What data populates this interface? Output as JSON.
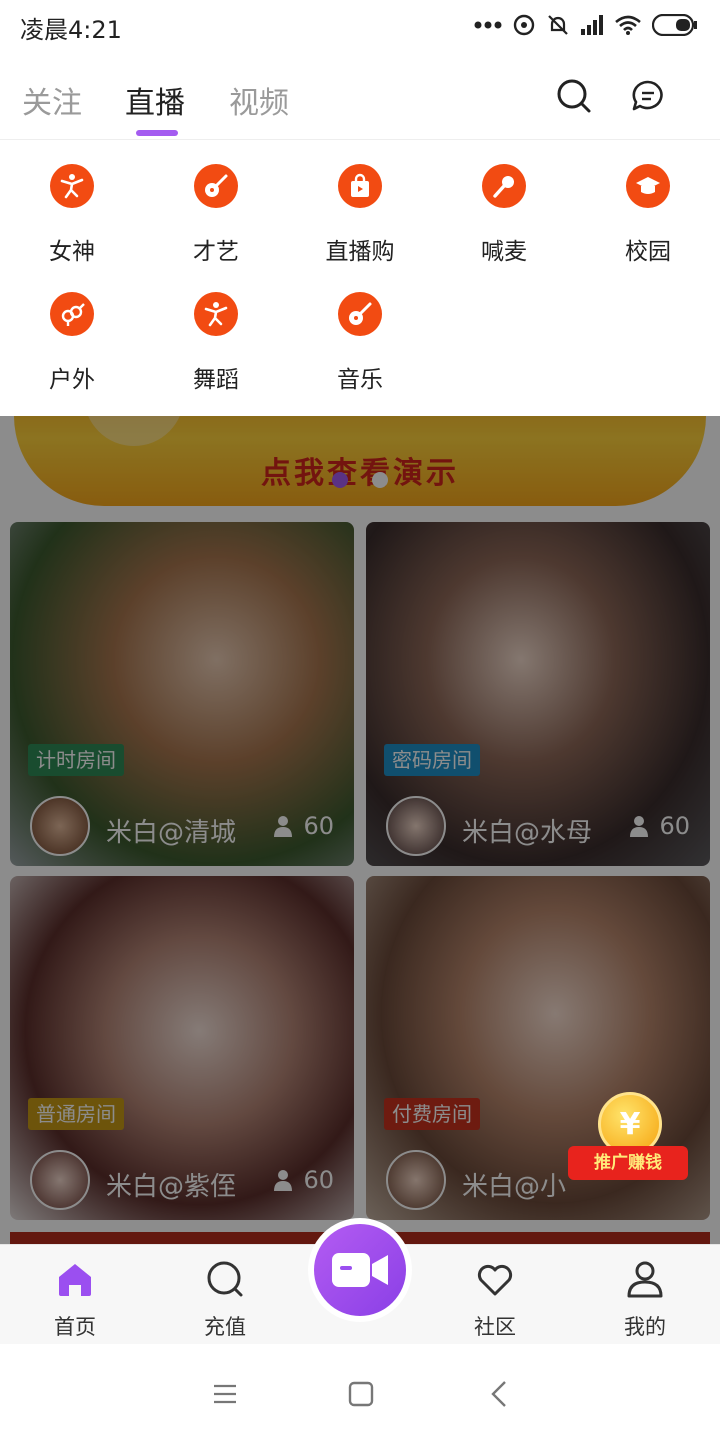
{
  "status_bar": {
    "time": "凌晨4:21"
  },
  "top_nav": {
    "tabs": [
      {
        "label": "关注",
        "active": false
      },
      {
        "label": "直播",
        "active": true
      },
      {
        "label": "视频",
        "active": false
      }
    ],
    "accent_color": "#a45cf0",
    "icons": [
      "search-icon",
      "message-icon"
    ]
  },
  "categories": [
    {
      "label": "女神",
      "icon": "dancer-icon"
    },
    {
      "label": "才艺",
      "icon": "guitar-icon"
    },
    {
      "label": "直播购",
      "icon": "shopping-bag-icon"
    },
    {
      "label": "喊麦",
      "icon": "microphone-icon"
    },
    {
      "label": "校园",
      "icon": "graduation-cap-icon"
    },
    {
      "label": "户外",
      "icon": "gender-icon"
    },
    {
      "label": "舞蹈",
      "icon": "dancer-icon"
    },
    {
      "label": "音乐",
      "icon": "guitar-icon"
    }
  ],
  "category_icon_color": "#f24b12",
  "banner": {
    "text": "点我查看演示",
    "active_dot": 0,
    "dot_count": 2
  },
  "cards": [
    {
      "room_type": "计时房间",
      "badge_color": "#2e8b57",
      "streamer": "米白@清城",
      "viewers": "60"
    },
    {
      "room_type": "密码房间",
      "badge_color": "#1e90c8",
      "streamer": "米白@水母",
      "viewers": "60"
    },
    {
      "room_type": "普通房间",
      "badge_color": "#c79a14",
      "streamer": "米白@紫侄",
      "viewers": "60"
    },
    {
      "room_type": "付费房间",
      "badge_color": "#c8321e",
      "streamer": "米白@小",
      "viewers": ""
    }
  ],
  "promo": {
    "coin_symbol": "¥",
    "label": "推广赚钱"
  },
  "bottom_nav": {
    "items": [
      {
        "label": "首页",
        "icon": "home-icon",
        "active": true
      },
      {
        "label": "充值",
        "icon": "recharge-icon",
        "active": false
      },
      {
        "label": "社区",
        "icon": "heart-icon",
        "active": false
      },
      {
        "label": "我的",
        "icon": "profile-icon",
        "active": false
      }
    ],
    "center_button": "video-camera-icon"
  },
  "system_nav": [
    "menu-icon",
    "home-square-icon",
    "back-icon"
  ]
}
